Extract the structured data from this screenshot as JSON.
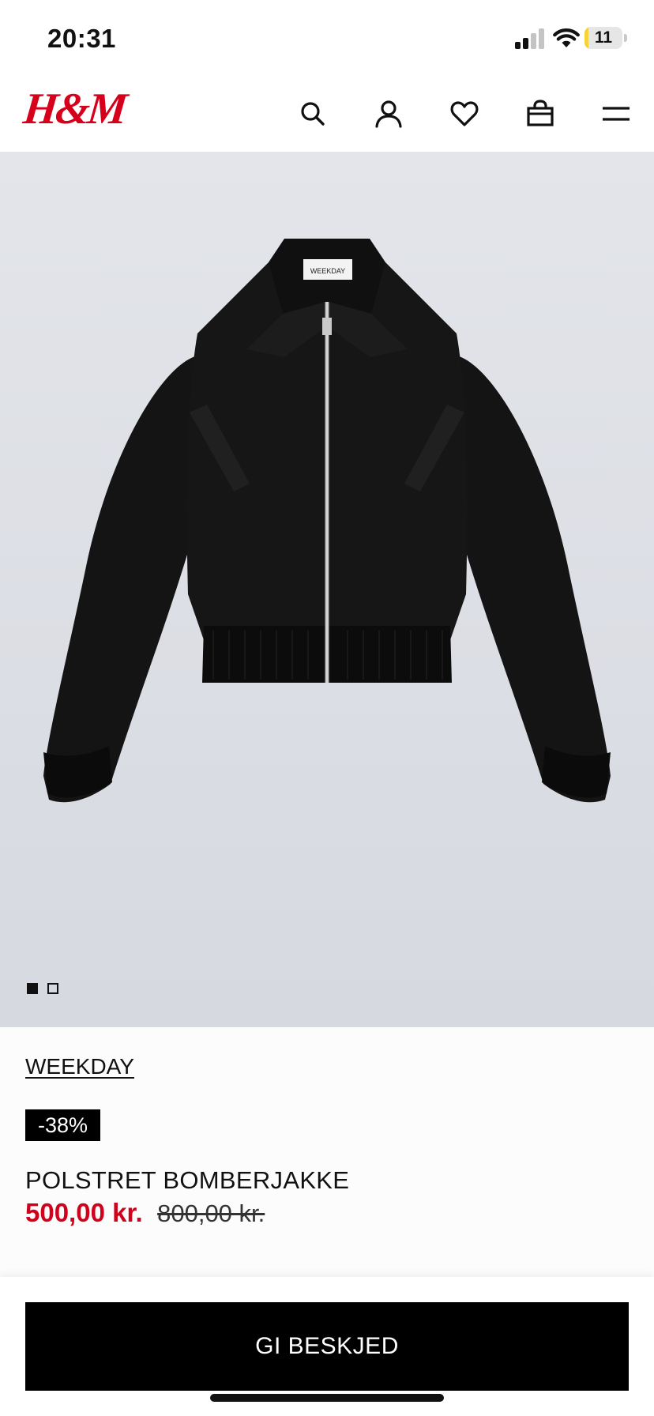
{
  "status_bar": {
    "time": "20:31",
    "battery_level": "11",
    "battery_fraction": 0.11,
    "battery_color": "#f7d33a",
    "signal_bars_active": 2,
    "signal_bars_total": 4
  },
  "header": {
    "logo": "H&M",
    "logo_color": "#d6001c",
    "icons": [
      "search-icon",
      "account-icon",
      "favorites-icon",
      "shopping-bag-icon",
      "menu-icon"
    ]
  },
  "gallery": {
    "image": "black-bomber-jacket",
    "image_count": 2,
    "active_index": 0,
    "label_text": "WEEKDAY"
  },
  "product": {
    "brand": "WEEKDAY",
    "discount_badge": "-38%",
    "name": "POLSTRET BOMBERJAKKE",
    "sale_price": "500,00 kr.",
    "original_price": "800,00 kr.",
    "sale_color": "#d0021b"
  },
  "cta": {
    "label": "GI BESKJED"
  }
}
